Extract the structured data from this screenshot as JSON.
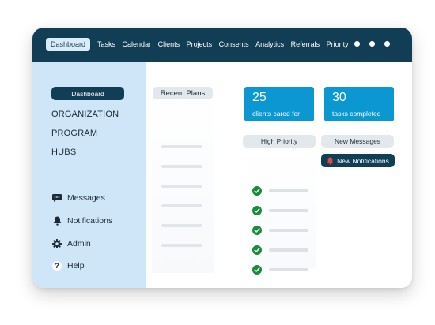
{
  "nav": {
    "items": [
      "Dashboard",
      "Tasks",
      "Calendar",
      "Clients",
      "Projects",
      "Consents",
      "Analytics",
      "Referrals",
      "Priority"
    ],
    "active_index": 0
  },
  "sidebar": {
    "dashboard_label": "Dashboard",
    "headings": [
      "ORGANIZATION",
      "PROGRAM",
      "HUBS"
    ],
    "links": [
      {
        "label": "Messages",
        "icon": "chat-icon"
      },
      {
        "label": "Notifications",
        "icon": "bell-icon"
      },
      {
        "label": "Admin",
        "icon": "gear-icon"
      },
      {
        "label": "Help",
        "icon": "help-icon"
      }
    ]
  },
  "main": {
    "recent_plans_label": "Recent Plans",
    "stats": [
      {
        "number": "25",
        "label": "clients cared for"
      },
      {
        "number": "30",
        "label": "tasks completed"
      }
    ],
    "high_priority_label": "High Priority",
    "new_messages_label": "New Messages",
    "new_notifications_label": "New Notifications"
  },
  "colors": {
    "topbar": "#123e55",
    "sidebar": "#cfe6f8",
    "accent": "#0b97d1",
    "check": "#1a8a3c",
    "bell": "#e24a3b"
  }
}
